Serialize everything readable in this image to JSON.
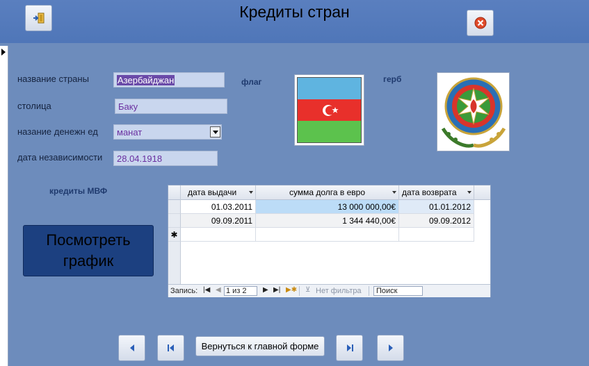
{
  "title": "Кредиты стран",
  "labels": {
    "country_name": "название страны",
    "capital": "столица",
    "currency": "назание денежн ед",
    "independence_date": "дата независимости",
    "flag": "флаг",
    "coat_of_arms": "герб",
    "imf_loans": "кредиты МВФ"
  },
  "fields": {
    "country_name": "Азербайджан",
    "capital": "Баку",
    "currency": "манат",
    "independence_date": "28.04.1918"
  },
  "buttons": {
    "show_chart": "Посмотреть график",
    "back_to_main": "Вернуться к главной форме"
  },
  "grid": {
    "columns": [
      "дата выдачи",
      "сумма долга в евро",
      "дата возврата"
    ],
    "rows": [
      [
        "01.03.2011",
        "13 000 000,00€",
        "01.01.2012"
      ],
      [
        "09.09.2011",
        "1 344 440,00€",
        "09.09.2012"
      ]
    ],
    "new_row_marker": "✱",
    "nav": {
      "record_label": "Запись:",
      "position": "1 из 2",
      "filter": "Нет фильтра",
      "search": "Поиск"
    }
  },
  "colors": {
    "header": "#5a7fbf",
    "body": "#6d8cbc",
    "big_button": "#1c4080",
    "flag_blue": "#5fb4e0",
    "flag_red": "#e8302b",
    "flag_green": "#5cc24d"
  }
}
